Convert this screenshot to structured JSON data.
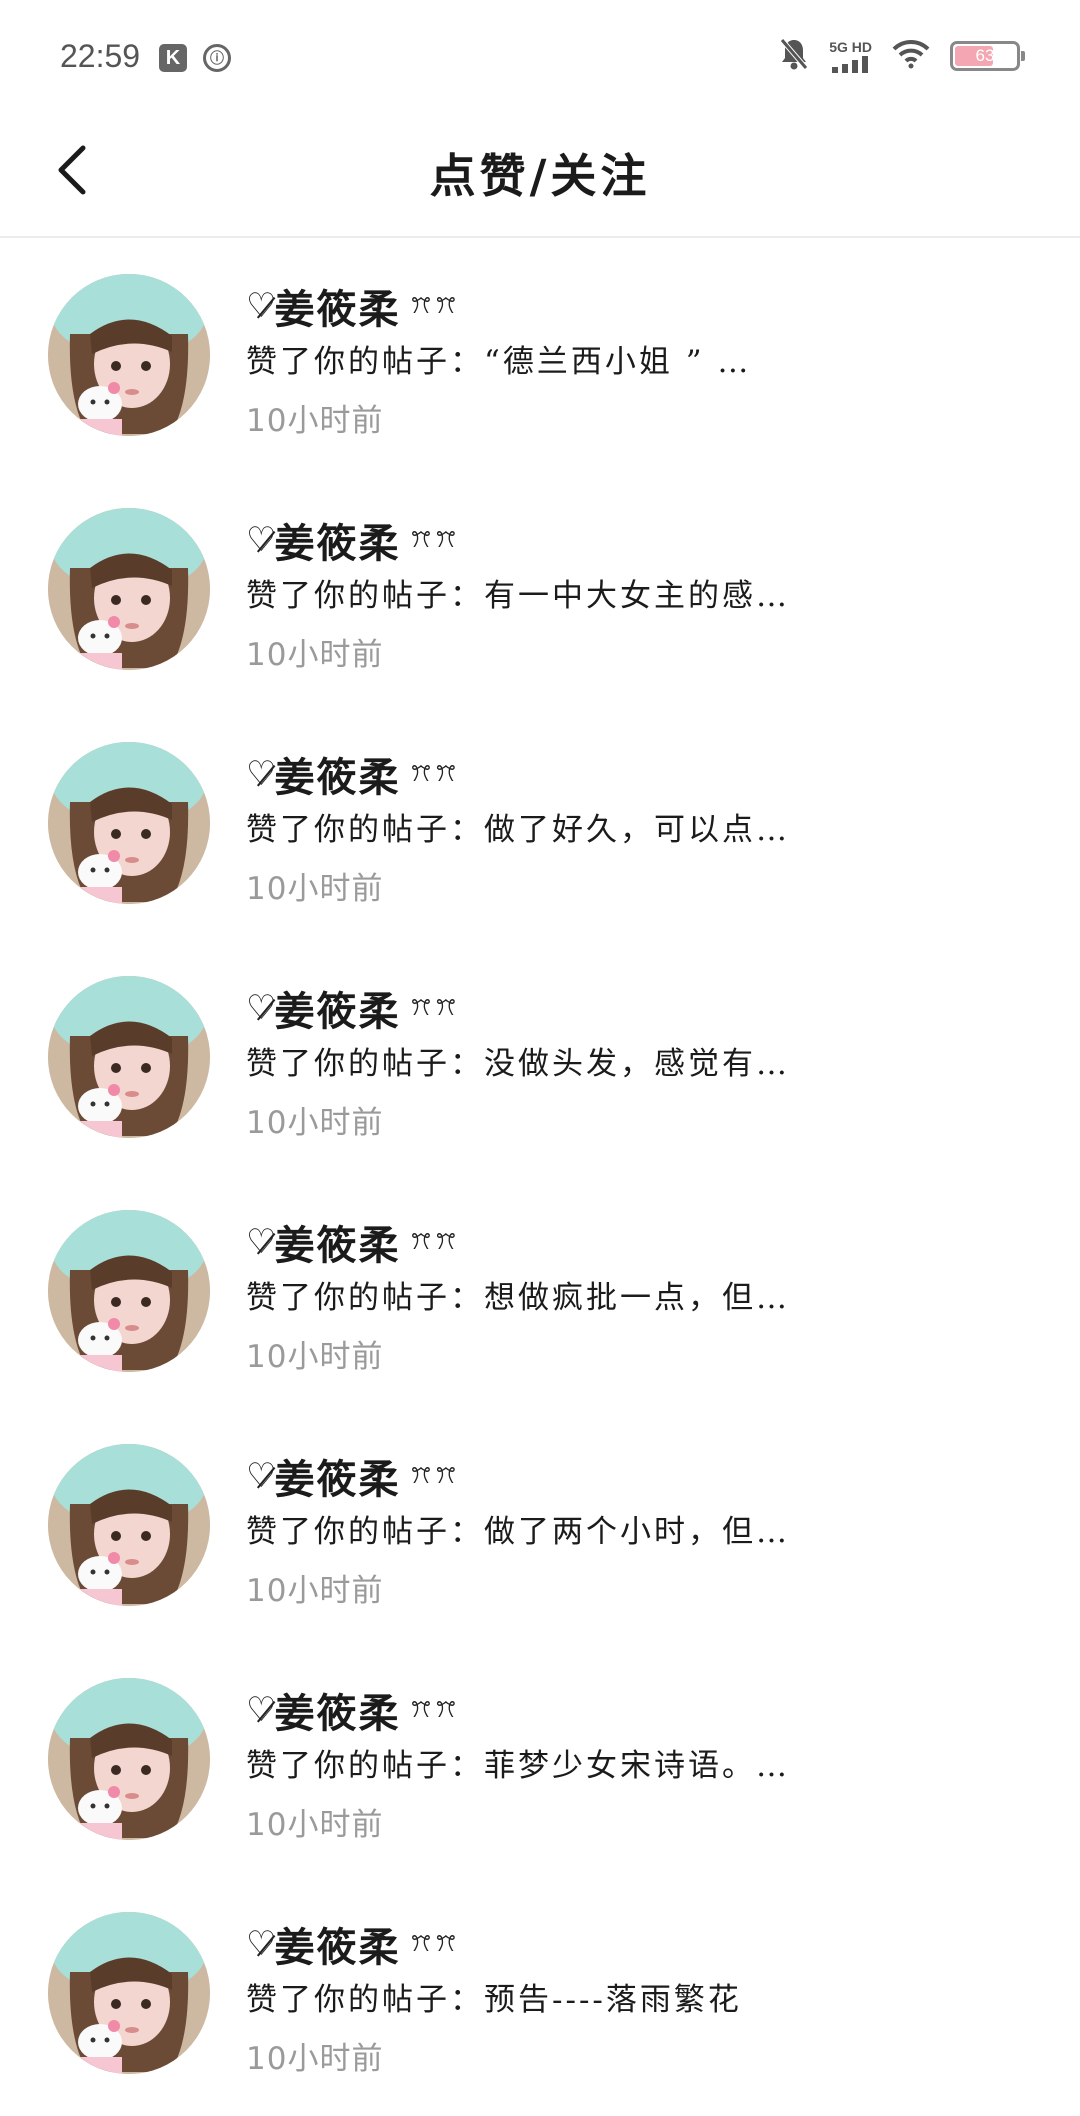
{
  "status_bar": {
    "time": "22:59",
    "app_icon_1": "K",
    "app_icon_2": "ⓘ",
    "network_label": "5G HD",
    "battery_level": 63,
    "battery_text": "63",
    "battery_color": "#f4a7b2",
    "icons": [
      "k-app-icon",
      "circle-app-icon",
      "bell-muted-icon",
      "signal-icon",
      "wifi-icon",
      "battery-icon"
    ]
  },
  "header": {
    "back_icon": "chevron-left-icon",
    "title": "点赞/关注"
  },
  "notifications": [
    {
      "deco_left": "♡̷",
      "user": "姜筱柔",
      "deco_right": "ꔫꔫ",
      "action": "赞了你的帖子：“德兰西小姐 ” …",
      "time": "10小时前"
    },
    {
      "deco_left": "♡̷",
      "user": "姜筱柔",
      "deco_right": "ꔫꔫ",
      "action": "赞了你的帖子：有一中大女主的感…",
      "time": "10小时前"
    },
    {
      "deco_left": "♡̷",
      "user": "姜筱柔",
      "deco_right": "ꔫꔫ",
      "action": "赞了你的帖子：做了好久，可以点…",
      "time": "10小时前"
    },
    {
      "deco_left": "♡̷",
      "user": "姜筱柔",
      "deco_right": "ꔫꔫ",
      "action": "赞了你的帖子：没做头发，感觉有…",
      "time": "10小时前"
    },
    {
      "deco_left": "♡̷",
      "user": "姜筱柔",
      "deco_right": "ꔫꔫ",
      "action": "赞了你的帖子：想做疯批一点，但…",
      "time": "10小时前"
    },
    {
      "deco_left": "♡̷",
      "user": "姜筱柔",
      "deco_right": "ꔫꔫ",
      "action": "赞了你的帖子：做了两个小时，但…",
      "time": "10小时前"
    },
    {
      "deco_left": "♡̷",
      "user": "姜筱柔",
      "deco_right": "ꔫꔫ",
      "action": "赞了你的帖子：菲梦少女宋诗语。…",
      "time": "10小时前"
    },
    {
      "deco_left": "♡̷",
      "user": "姜筱柔",
      "deco_right": "ꔫꔫ",
      "action": "赞了你的帖子：预告----落雨繁花",
      "time": "10小时前"
    }
  ]
}
